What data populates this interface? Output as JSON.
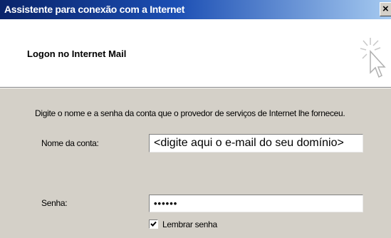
{
  "window": {
    "title": "Assistente para conexão com a Internet",
    "close_glyph": "×"
  },
  "header": {
    "title": "Logon no Internet Mail",
    "icon": "wizard-cursor-icon"
  },
  "form": {
    "instruction": "Digite o nome e a senha da conta que o provedor de serviços de Internet lhe forneceu.",
    "account_label": "Nome da conta:",
    "account_value": "<digite aqui o e-mail do seu domínio>",
    "password_label": "Senha:",
    "password_value": "••••••",
    "remember_label": "Lembrar senha",
    "remember_checked": true
  }
}
